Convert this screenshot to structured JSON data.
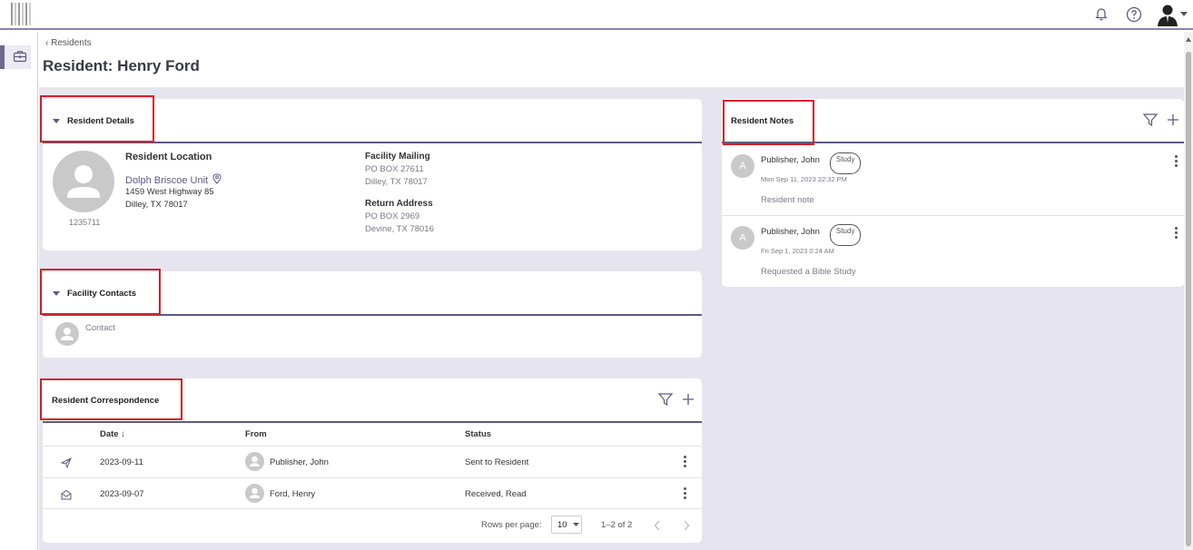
{
  "breadcrumb": {
    "label": "Residents"
  },
  "page": {
    "title": "Resident: Henry Ford"
  },
  "resident_details": {
    "title": "Resident Details",
    "id": "1235711",
    "location_label": "Resident Location",
    "unit_name": "Dolph Briscoe Unit",
    "address_line1": "1459 West Highway 85",
    "address_line2": "Dilley, TX 78017",
    "mailing_label": "Facility Mailing",
    "mailing_line1": "PO BOX 27611",
    "mailing_line2": "Dilley, TX 78017",
    "return_label": "Return Address",
    "return_line1": "PO BOX 2969",
    "return_line2": "Devine, TX 78016"
  },
  "facility_contacts": {
    "title": "Facility Contacts",
    "contact_label": "Contact"
  },
  "correspondence": {
    "title": "Resident Correspondence",
    "columns": {
      "date": "Date",
      "from": "From",
      "status": "Status"
    },
    "rows": [
      {
        "icon": "send-icon",
        "date": "2023-09-11",
        "from": "Publisher, John",
        "status": "Sent to Resident"
      },
      {
        "icon": "envelope-open-icon",
        "date": "2023-09-07",
        "from": "Ford, Henry",
        "status": "Received, Read"
      }
    ],
    "pagination": {
      "rows_per_page_label": "Rows per page:",
      "rows_per_page": "10",
      "range": "1–2 of 2"
    }
  },
  "notes": {
    "title": "Resident Notes",
    "items": [
      {
        "initial": "A",
        "author": "Publisher, John",
        "tag": "Study",
        "timestamp": "Mon Sep 11, 2023 22:32 PM",
        "text": "Resident note"
      },
      {
        "initial": "A",
        "author": "Publisher, John",
        "tag": "Study",
        "timestamp": "Fri Sep 1, 2023 0:24 AM",
        "text": "Requested a Bible Study"
      }
    ]
  },
  "colors": {
    "accent": "#5d5a80",
    "highlight": "#d3202a",
    "background": "#e6e4ee"
  }
}
